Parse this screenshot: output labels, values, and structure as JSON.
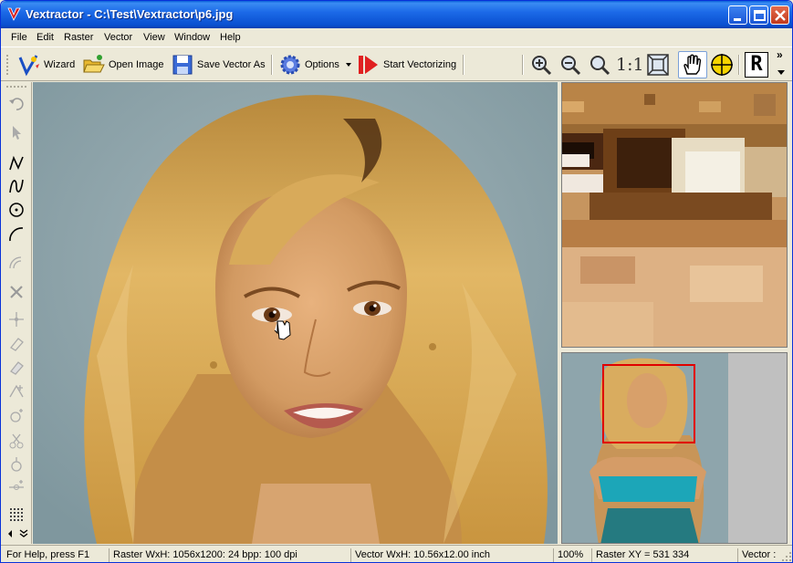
{
  "window": {
    "title": "Vextractor - C:\\Test\\Vextractor\\p6.jpg"
  },
  "menu": {
    "items": [
      "File",
      "Edit",
      "Raster",
      "Vector",
      "View",
      "Window",
      "Help"
    ]
  },
  "toolbar": {
    "wizard_label": "Wizard",
    "open_label": "Open Image",
    "save_label": "Save Vector As",
    "options_label": "Options",
    "start_label": "Start Vectorizing",
    "actual_size_label": "1:1",
    "mode_label": "R",
    "more_label": "»"
  },
  "icons": {
    "wizard": "wizard-icon",
    "open": "folder-open-icon",
    "save": "floppy-disk-icon",
    "options": "gear-icon",
    "start": "play-icon",
    "zoom_in": "zoom-in-icon",
    "zoom_out": "zoom-out-icon",
    "zoom": "magnifier-icon",
    "fit": "fit-window-icon",
    "hand": "hand-icon",
    "crosshair": "crosshair-icon"
  },
  "statusbar": {
    "help": "For Help, press F1",
    "raster": "Raster WxH: 1056x1200: 24 bpp: 100 dpi",
    "vector": "Vector WxH: 10.56x12.00 inch",
    "zoom": "100%",
    "raster_xy": "Raster XY =  531  334",
    "vector_short": "Vector :"
  },
  "colors": {
    "title_bar": "#0a50d0",
    "nav_frame": "#e00000",
    "background": "#ece9d8"
  }
}
